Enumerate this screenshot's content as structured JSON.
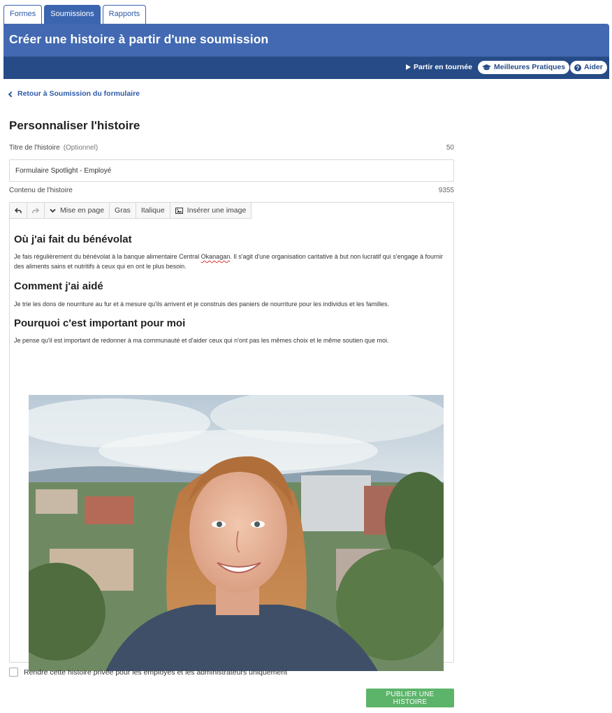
{
  "tabs": [
    {
      "label": "Formes",
      "active": false
    },
    {
      "label": "Soumissions",
      "active": true
    },
    {
      "label": "Rapports",
      "active": false
    }
  ],
  "header": {
    "title": "Créer une histoire à partir d'une soumission",
    "tour_label": "Partir en tournée",
    "best_practices_label": "Meilleures Pratiques",
    "help_label": "Aider"
  },
  "back_link": "Retour à Soumission du formulaire",
  "section_title": "Personnaliser l'histoire",
  "story_title": {
    "label": "Titre de l'histoire",
    "optional": "(Optionnel)",
    "counter": "50",
    "value": "Formulaire Spotlight - Employé"
  },
  "story_content": {
    "label": "Contenu de l'histoire",
    "counter": "9355"
  },
  "toolbar": {
    "format_label": "Mise en page",
    "bold_label": "Gras",
    "italic_label": "Italique",
    "insert_image_label": "Insérer une image"
  },
  "content": {
    "heading_1": "Où j'ai fait du bénévolat",
    "para_1_before": "Je fais régulièrement du bénévolat à la banque alimentaire Central ",
    "para_1_spell": "Okanagan",
    "para_1_after": ". Il s'agit d'une organisation caritative à but non lucratif qui s'engage à fournir des aliments sains et nutritifs à ceux qui en ont le plus besoin.",
    "heading_2": "Comment j'ai aidé",
    "para_2": "Je trie les dons de nourriture au fur et à mesure qu'ils arrivent et je construis des paniers de nourriture pour les individus et les familles.",
    "heading_3": "Pourquoi c'est important pour moi",
    "para_3": "Je pense qu'il est important de redonner à ma communauté et d'aider ceux qui n'ont pas les mêmes choix et le même soutien que moi."
  },
  "private_checkbox": {
    "label": "Rendre cette histoire privée pour les employés et les administrateurs uniquement",
    "checked": false
  },
  "publish_label": "PUBLIER UNE HISTOIRE",
  "colors": {
    "header_bg": "#4269b2",
    "subbar_bg": "#264b86",
    "link": "#2d5aa6",
    "publish_bg": "#5cb46a"
  }
}
